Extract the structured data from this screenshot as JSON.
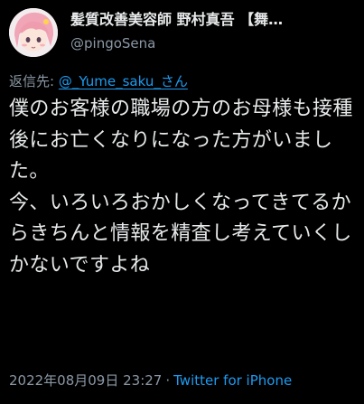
{
  "author": {
    "display_name": "髪質改善美容師 野村真吾 【舞…",
    "handle": "@pingoSena",
    "avatar": "anime-character-avatar"
  },
  "reply": {
    "prefix": "返信先: ",
    "mention": "@_Yume_saku_さん"
  },
  "body": {
    "text": "僕のお客様の職場の方のお母様も接種後にお亡くなりになった方がいました。\n今、いろいろおかしくなってきてるからきちんと情報を精査し考えていくしかないですよね"
  },
  "meta": {
    "timestamp": "2022年08月09日 23:27",
    "separator": "·",
    "source": "Twitter for iPhone"
  },
  "colors": {
    "background": "#000000",
    "text": "#e7e9ea",
    "secondary": "#8b98a5",
    "link": "#1d9bf0"
  }
}
